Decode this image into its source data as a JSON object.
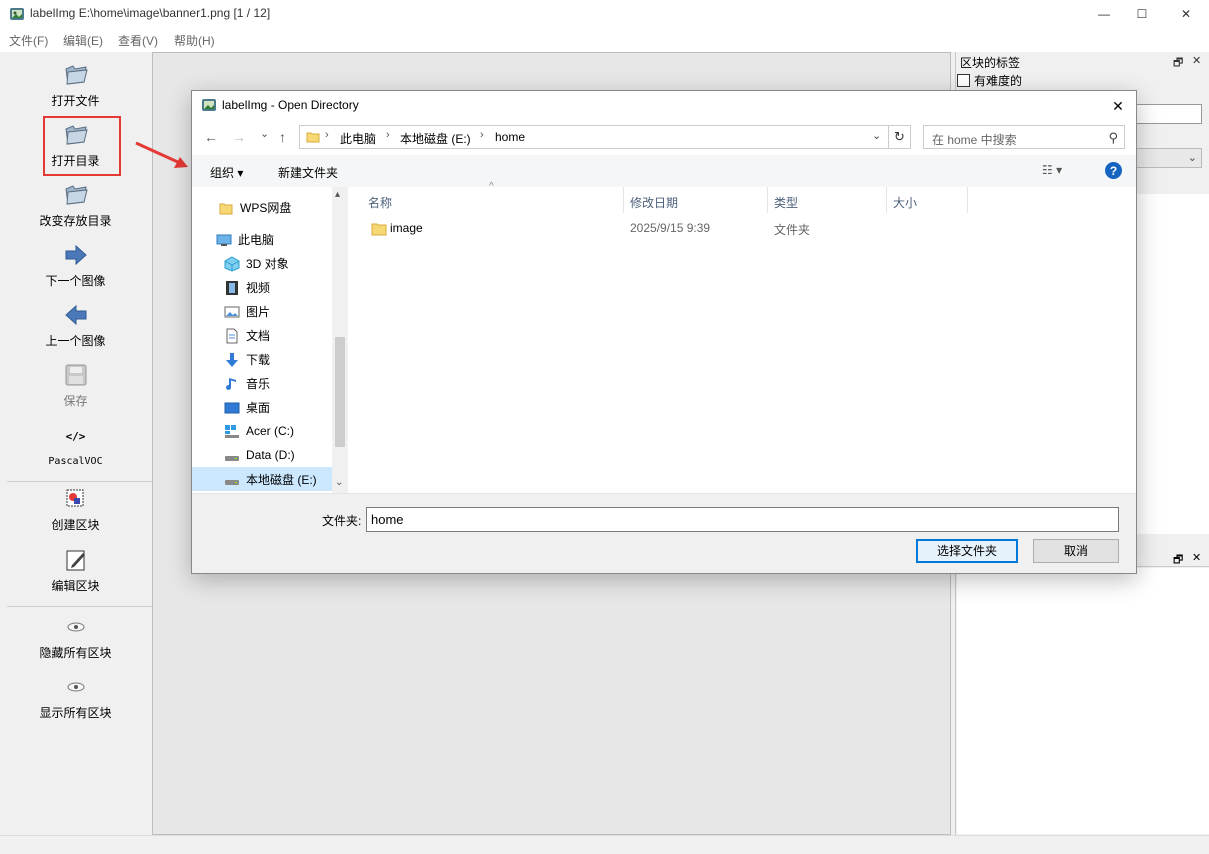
{
  "window": {
    "title": "labelImg E:\\home\\image\\banner1.png [1 / 12]",
    "minimize_icon": "—",
    "maximize_icon": "☐",
    "close_icon": "✕"
  },
  "menu": [
    "文件(F)",
    "编辑(E)",
    "查看(V)",
    "帮助(H)"
  ],
  "toolbar": {
    "open_file": "打开文件",
    "open_dir": "打开目录",
    "change_save_dir": "改变存放目录",
    "next_image": "下一个图像",
    "prev_image": "上一个图像",
    "save": "保存",
    "format_icon": "</>",
    "format": "PascalVOC",
    "create_box": "创建区块",
    "edit_box": "编辑区块",
    "hide_all": "隐藏所有区块",
    "show_all": "显示所有区块"
  },
  "dock": {
    "title": "区块的标签",
    "float_icon": "🗗",
    "close_icon": "✕",
    "difficult": "有难度的"
  },
  "dialog": {
    "title": "labelImg - Open Directory",
    "close_icon": "✕",
    "nav": {
      "back": "←",
      "forward": "→",
      "recent": "⌄",
      "up": "↑"
    },
    "address": [
      "此电脑",
      "本地磁盘 (E:)",
      "home"
    ],
    "address_sep": "›",
    "address_chevron": "⌄",
    "refresh_icon": "↻",
    "search_placeholder": "在 home 中搜索",
    "search_icon": "⚲",
    "organize": "组织 ▾",
    "new_folder": "新建文件夹",
    "view_icon": "☷ ▾",
    "help_icon": "?",
    "nav_items": [
      "WPS网盘",
      "此电脑",
      "3D 对象",
      "视频",
      "图片",
      "文档",
      "下载",
      "音乐",
      "桌面",
      "Acer (C:)",
      "Data (D:)",
      "本地磁盘 (E:)"
    ],
    "scroll_up": "▴",
    "scroll_down": "⌄",
    "columns": [
      "名称",
      "修改日期",
      "类型",
      "大小"
    ],
    "sort_caret": "^",
    "files": [
      {
        "name": "image",
        "date": "2025/9/15 9:39",
        "type": "文件夹",
        "size": ""
      }
    ],
    "folder_label": "文件夹:",
    "folder_value": "home",
    "select_button": "选择文件夹",
    "cancel_button": "取消"
  },
  "colors": {
    "highlight": "#e53935",
    "arrow": "#e53935",
    "accent": "#0078d7",
    "help": "#1565c0"
  }
}
